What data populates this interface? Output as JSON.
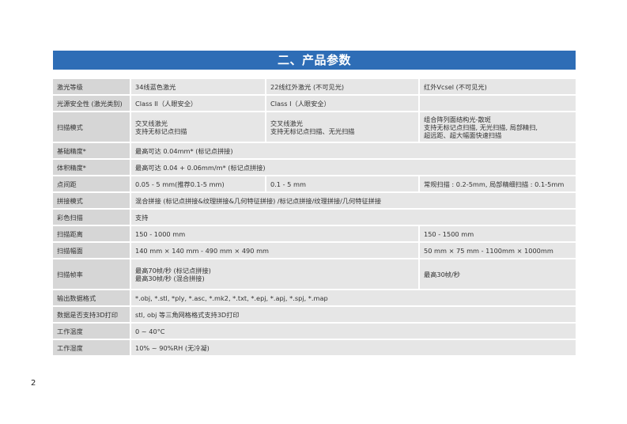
{
  "section_title": "二、产品参数",
  "page_number": "2",
  "rows": [
    {
      "label": "激光等级",
      "c1": "34线蓝色激光",
      "c2": "22线红外激光 (不可见光)",
      "c3": "红外Vcsel (不可见光)"
    },
    {
      "label": "光源安全性 (激光类别)",
      "c1": "Class II（人眼安全）",
      "c2": "Class I（人眼安全）"
    },
    {
      "label": "扫描模式",
      "c1": "交叉线激光\n支持无标记点扫描",
      "c2": "交叉线激光\n支持无标记点扫描、无光扫描",
      "c3": "组合阵列面结构光-散斑\n支持无标记点扫描, 无光扫描, 局部精扫,\n超远距、超大幅面快速扫描"
    },
    {
      "label": "基础精度*",
      "value": "最高可达 0.04mm* (标记点拼接)"
    },
    {
      "label": "体积精度*",
      "value": "最高可达 0.04 + 0.06mm/m* (标记点拼接)"
    },
    {
      "label": "点间距",
      "c1": "0.05 - 5 mm(推荐0.1-5 mm)",
      "c2": "0.1 - 5 mm",
      "c3": "常规扫描 : 0.2-5mm, 局部精细扫描 : 0.1-5mm"
    },
    {
      "label": "拼接模式",
      "value": "混合拼接 (标记点拼接&纹理拼接&几何特征拼接) /标记点拼接/纹理拼接/几何特征拼接"
    },
    {
      "label": "彩色扫描",
      "value": "支持"
    },
    {
      "label": "扫描距离",
      "left": "150 - 1000 mm",
      "right": "150 - 1500 mm"
    },
    {
      "label": "扫描幅面",
      "left": "140 mm × 140 mm - 490 mm × 490 mm",
      "right": "50 mm × 75 mm - 1100mm × 1000mm"
    },
    {
      "label": "扫描帧率",
      "left": "最高70帧/秒 (标记点拼接)\n最高30帧/秒 (混合拼接)",
      "right": "最高30帧/秒"
    },
    {
      "label": "输出数据格式",
      "value": "*.obj, *.stl, *ply, *.asc, *.mk2, *.txt, *.epj, *.apj, *.spj, *.map"
    },
    {
      "label": "数据是否支持3D打印",
      "value": "stl, obj 等三角网格格式支持3D打印"
    },
    {
      "label": "工作温度",
      "value": "0 ~ 40°C"
    },
    {
      "label": "工作湿度",
      "value": "10% ~ 90%RH (无冷凝)"
    }
  ]
}
